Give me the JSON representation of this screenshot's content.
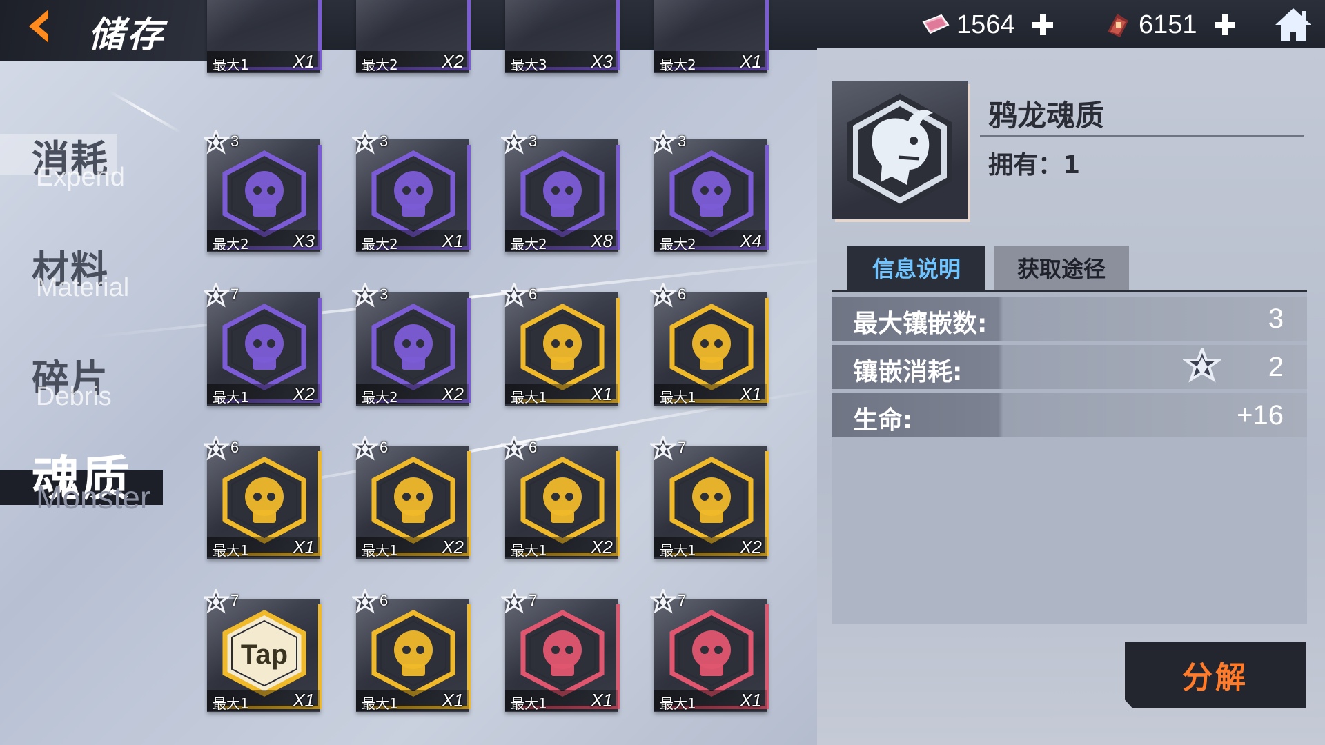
{
  "header": {
    "title": "储存",
    "currencies": [
      {
        "icon": "gem-ticket-icon",
        "value": "1564"
      },
      {
        "icon": "chip-currency-icon",
        "value": "6151"
      }
    ]
  },
  "nav": {
    "items": [
      {
        "cn": "消耗",
        "en": "Expend",
        "active": false
      },
      {
        "cn": "材料",
        "en": "Material",
        "active": false
      },
      {
        "cn": "碎片",
        "en": "Debris",
        "active": false
      },
      {
        "cn": "魂质",
        "en": "Monster",
        "active": true
      }
    ]
  },
  "grid": {
    "top_partial": [
      {
        "max": "最大1",
        "qty": "X1"
      },
      {
        "max": "最大2",
        "qty": "X2"
      },
      {
        "max": "最大3",
        "qty": "X3"
      },
      {
        "max": "最大2",
        "qty": "X1"
      }
    ],
    "items": [
      {
        "level": "3",
        "max": "最大2",
        "qty": "X3",
        "rarity": "purple",
        "icon": "skull-helmet-icon"
      },
      {
        "level": "3",
        "max": "最大2",
        "qty": "X1",
        "rarity": "purple",
        "icon": "grid-orb-icon"
      },
      {
        "level": "3",
        "max": "最大2",
        "qty": "X8",
        "rarity": "purple",
        "icon": "spiky-goggles-icon"
      },
      {
        "level": "3",
        "max": "最大2",
        "qty": "X4",
        "rarity": "purple",
        "icon": "hooded-girl-icon"
      },
      {
        "level": "7",
        "max": "最大1",
        "qty": "X2",
        "rarity": "purple",
        "icon": "crowned-beast-icon"
      },
      {
        "level": "3",
        "max": "最大2",
        "qty": "X2",
        "rarity": "purple",
        "icon": "shadow-tree-icon"
      },
      {
        "level": "6",
        "max": "最大1",
        "qty": "X1",
        "rarity": "gold",
        "icon": "rune-shield-icon"
      },
      {
        "level": "6",
        "max": "最大1",
        "qty": "X1",
        "rarity": "gold",
        "icon": "bird-skull-icon"
      },
      {
        "level": "6",
        "max": "最大1",
        "qty": "X1",
        "rarity": "gold",
        "icon": "beast-skull-icon"
      },
      {
        "level": "6",
        "max": "最大1",
        "qty": "X2",
        "rarity": "gold",
        "icon": "keyhole-golem-icon"
      },
      {
        "level": "6",
        "max": "最大1",
        "qty": "X2",
        "rarity": "gold",
        "icon": "crow-wing-icon"
      },
      {
        "level": "7",
        "max": "最大1",
        "qty": "X2",
        "rarity": "gold",
        "icon": "pyramid-eye-icon"
      },
      {
        "level": "7",
        "max": "最大1",
        "qty": "X1",
        "rarity": "gold",
        "icon": "tap-badge-icon",
        "label": "Tap"
      },
      {
        "level": "6",
        "max": "最大1",
        "qty": "X1",
        "rarity": "gold",
        "icon": "cracked-crest-icon"
      },
      {
        "level": "7",
        "max": "最大1",
        "qty": "X1",
        "rarity": "red",
        "icon": "dragon-face-icon"
      },
      {
        "level": "7",
        "max": "最大1",
        "qty": "X1",
        "rarity": "red",
        "icon": "horned-demon-icon"
      }
    ]
  },
  "detail": {
    "icon": "crow-dragon-icon",
    "name": "鸦龙魂质",
    "owned": "拥有：1",
    "tabs": [
      {
        "label": "信息说明",
        "active": true
      },
      {
        "label": "获取途径",
        "active": false
      }
    ],
    "stats": [
      {
        "key": "最大镶嵌数:",
        "value": "3"
      },
      {
        "key": "镶嵌消耗:",
        "value": "2",
        "icon": "star-cost-icon"
      },
      {
        "key": "生命:",
        "value": "+16"
      }
    ],
    "decompose_label": "分解"
  },
  "colors": {
    "purple": "#7c5cd6",
    "gold": "#f0b92a",
    "red": "#e0566f",
    "accent_orange": "#ff7b2a",
    "tab_blue": "#6fc3ff"
  }
}
